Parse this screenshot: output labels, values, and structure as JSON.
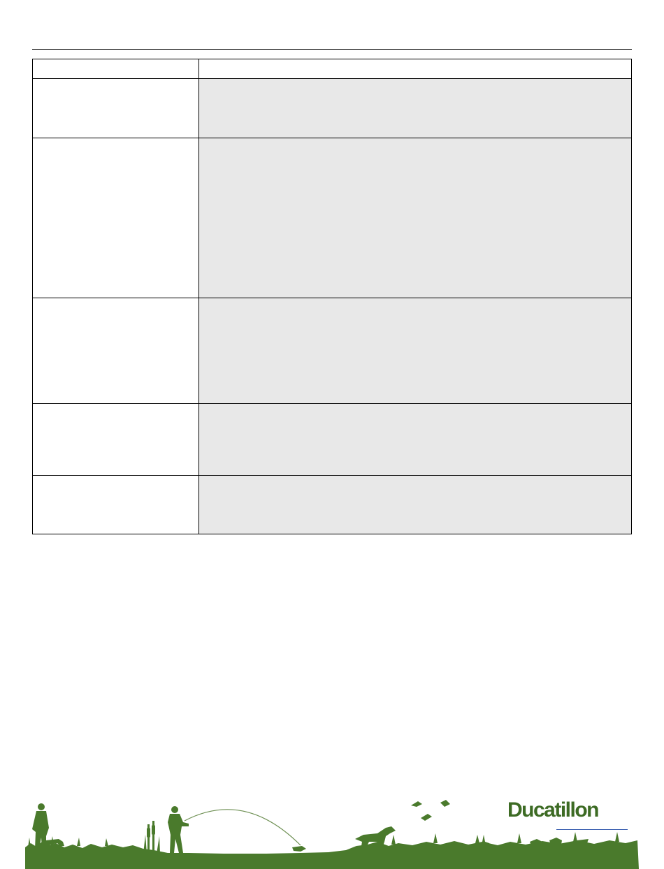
{
  "brand": {
    "name": "Ducatillon",
    "color": "#3d6b24"
  },
  "table": {
    "header": [
      "",
      ""
    ],
    "rows": [
      {
        "label": "",
        "value": ""
      },
      {
        "label": "",
        "value": ""
      },
      {
        "label": "",
        "value": ""
      },
      {
        "label": "",
        "value": ""
      },
      {
        "label": "",
        "value": ""
      }
    ]
  },
  "colors": {
    "value_cell_bg": "#e8e8e8",
    "footer_green": "#4a7a2c"
  }
}
